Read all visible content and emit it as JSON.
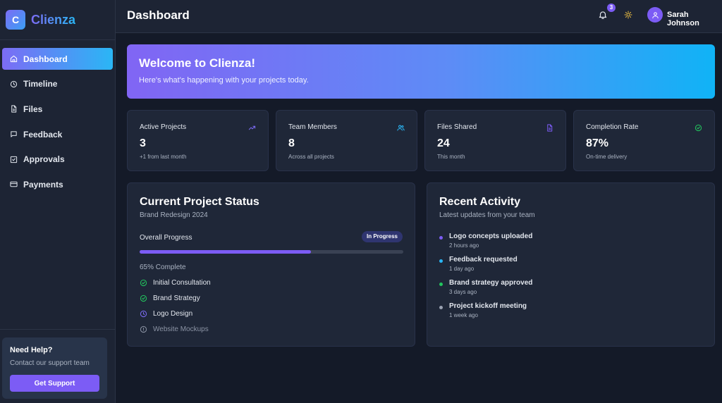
{
  "brand": {
    "logo_letter": "C",
    "name": "Clienza"
  },
  "sidebar": {
    "items": [
      {
        "label": "Dashboard",
        "icon": "home-icon",
        "active": true
      },
      {
        "label": "Timeline",
        "icon": "clock-icon"
      },
      {
        "label": "Files",
        "icon": "file-icon"
      },
      {
        "label": "Feedback",
        "icon": "message-icon"
      },
      {
        "label": "Approvals",
        "icon": "check-square-icon"
      },
      {
        "label": "Payments",
        "icon": "credit-card-icon"
      }
    ],
    "help": {
      "title": "Need Help?",
      "text": "Contact our support team",
      "button": "Get Support"
    }
  },
  "header": {
    "title": "Dashboard",
    "notifications_count": "3",
    "user_name": "Sarah Johnson"
  },
  "welcome": {
    "title": "Welcome to Clienza!",
    "subtitle": "Here's what's happening with your projects today."
  },
  "stats": [
    {
      "label": "Active Projects",
      "value": "3",
      "sub": "+1 from last month",
      "icon": "trending-up-icon",
      "color": "#7c6cf5"
    },
    {
      "label": "Team Members",
      "value": "8",
      "sub": "Across all projects",
      "icon": "users-icon",
      "color": "#2ab6f5"
    },
    {
      "label": "Files Shared",
      "value": "24",
      "sub": "This month",
      "icon": "file-text-icon",
      "color": "#7c5cf5"
    },
    {
      "label": "Completion Rate",
      "value": "87%",
      "sub": "On-time delivery",
      "icon": "check-circle-icon",
      "color": "#22c55e"
    }
  ],
  "project_status": {
    "title": "Current Project Status",
    "project": "Brand Redesign 2024",
    "progress_label": "Overall Progress",
    "status": "In Progress",
    "progress_percent": 65,
    "progress_text": "65% Complete",
    "steps": [
      {
        "label": "Initial Consultation",
        "state": "done"
      },
      {
        "label": "Brand Strategy",
        "state": "done"
      },
      {
        "label": "Logo Design",
        "state": "active"
      },
      {
        "label": "Website Mockups",
        "state": "pending"
      }
    ]
  },
  "recent_activity": {
    "title": "Recent Activity",
    "subtitle": "Latest updates from your team",
    "items": [
      {
        "title": "Logo concepts uploaded",
        "time": "2 hours ago",
        "color": "#7c5cf5"
      },
      {
        "title": "Feedback requested",
        "time": "1 day ago",
        "color": "#2ab6f5"
      },
      {
        "title": "Brand strategy approved",
        "time": "3 days ago",
        "color": "#22c55e"
      },
      {
        "title": "Project kickoff meeting",
        "time": "1 week ago",
        "color": "#9aa2b2"
      }
    ]
  },
  "colors": {
    "accent": "#7c5cf5",
    "accent_2": "#2ab6f5",
    "success": "#22c55e"
  }
}
